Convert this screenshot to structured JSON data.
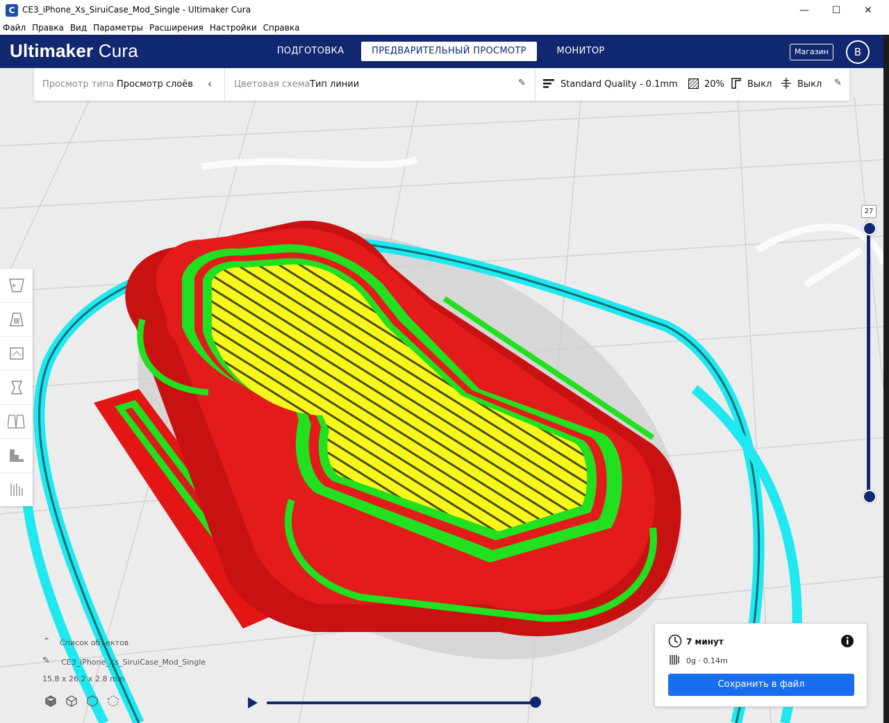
{
  "window": {
    "title": "CE3_iPhone_Xs_SiruiCase_Mod_Single - Ultimaker Cura",
    "app_icon_letter": "C",
    "minimize": "—",
    "maximize": "☐",
    "close": "✕"
  },
  "menubar": {
    "items": [
      "Файл",
      "Правка",
      "Вид",
      "Параметры",
      "Расширения",
      "Настройки",
      "Справка"
    ]
  },
  "header": {
    "logo_bold": "Ultimaker",
    "logo_light": "Cura",
    "tabs": [
      {
        "label": "ПОДГОТОВКА",
        "active": false
      },
      {
        "label": "ПРЕДВАРИТЕЛЬНЫЙ ПРОСМОТР",
        "active": true
      },
      {
        "label": "МОНИТОР",
        "active": false
      }
    ],
    "marketplace_label": "Магазин",
    "avatar_letter": "B"
  },
  "toolbar": {
    "view_type_label": "Просмотр типа",
    "view_type_value": "Просмотр слоёв",
    "color_scheme_label": "Цветовая схема",
    "color_scheme_value": "Тип линии",
    "profile": "Standard Quality - 0.1mm",
    "infill": "20%",
    "support": "Выкл",
    "adhesion": "Выкл"
  },
  "layer_slider": {
    "current_layer": "27",
    "max_fraction": 1.0,
    "min_fraction": 0.0
  },
  "objects_panel": {
    "list_label": "Список объектов",
    "object_name": "CE3_iPhone_Xs_SiruiCase_Mod_Single",
    "dimensions": "15.8 x 26.2 x 2.8 mm"
  },
  "print_info": {
    "time": "7 минут",
    "material": "0g · 0.14m",
    "save_label": "Сохранить в файл"
  },
  "colors": {
    "header_bg": "#11276f",
    "accent_blue": "#196ef0",
    "wall_outer": "#ff1c1c",
    "wall_inner": "#20e020",
    "top_bottom": "#f0f020",
    "skirt": "#1fe8f0"
  }
}
